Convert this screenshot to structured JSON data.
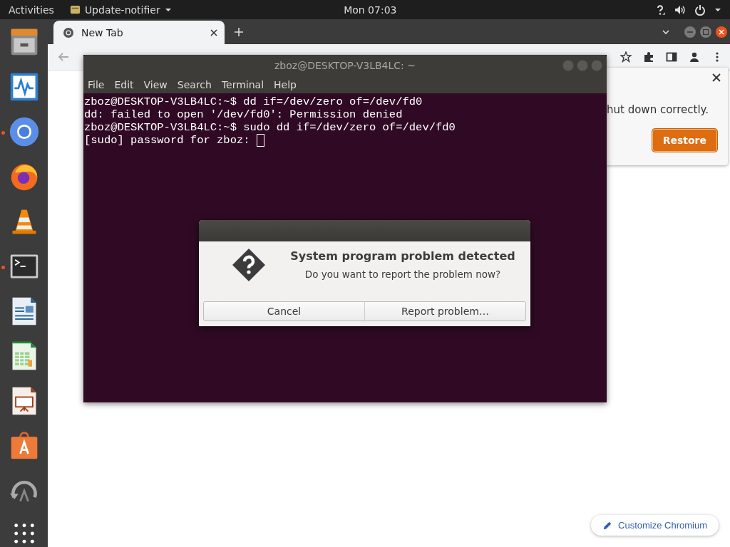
{
  "top_bar": {
    "activities": "Activities",
    "app_menu": "Update-notifier",
    "clock": "Mon 07:03"
  },
  "dock": {
    "items": [
      {
        "kind": "files",
        "running": false
      },
      {
        "kind": "monitor",
        "running": false
      },
      {
        "kind": "chromium",
        "running": true
      },
      {
        "kind": "firefox",
        "running": false
      },
      {
        "kind": "vlc",
        "running": false
      },
      {
        "kind": "terminal",
        "running": true
      },
      {
        "kind": "writer",
        "running": false
      },
      {
        "kind": "calc",
        "running": false
      },
      {
        "kind": "impress",
        "running": false
      },
      {
        "kind": "software",
        "running": false
      },
      {
        "kind": "updater",
        "running": false
      },
      {
        "kind": "apps",
        "running": false
      }
    ]
  },
  "browser": {
    "tabs": [
      {
        "label": "New Tab",
        "selected": true
      }
    ],
    "restore_bubble": {
      "message": "hut down correctly.",
      "button": "Restore"
    },
    "customize_button": "Customize Chromium"
  },
  "terminal": {
    "title": "zboz@DESKTOP-V3LB4LC: ~",
    "menu": [
      "File",
      "Edit",
      "View",
      "Search",
      "Terminal",
      "Help"
    ],
    "lines": [
      "zboz@DESKTOP-V3LB4LC:~$ dd if=/dev/zero of=/dev/fd0",
      "dd: failed to open '/dev/fd0': Permission denied",
      "zboz@DESKTOP-V3LB4LC:~$ sudo dd if=/dev/zero of=/dev/fd0",
      "[sudo] password for zboz: "
    ],
    "cursor": true
  },
  "dialog": {
    "title": "System program problem detected",
    "message": "Do you want to report the problem now?",
    "buttons": [
      "Cancel",
      "Report problem…"
    ]
  }
}
